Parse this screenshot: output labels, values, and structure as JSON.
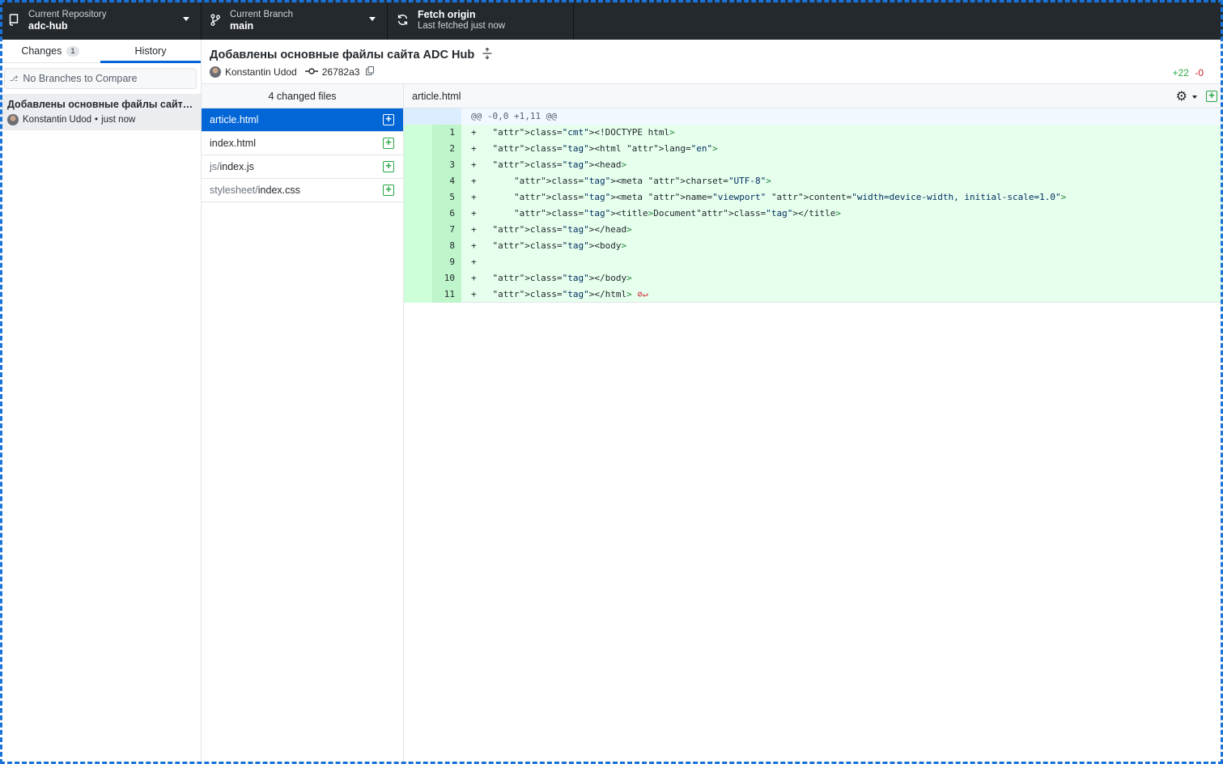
{
  "toolbar": {
    "repo": {
      "label": "Current Repository",
      "value": "adc-hub",
      "icon": "repo-icon"
    },
    "branch": {
      "label": "Current Branch",
      "value": "main",
      "icon": "branch-icon"
    },
    "fetch": {
      "label": "Fetch origin",
      "sub": "Last fetched just now",
      "icon": "sync-icon"
    }
  },
  "sidebar": {
    "tabs": [
      {
        "label": "Changes",
        "count": "1"
      },
      {
        "label": "History"
      }
    ],
    "compare_placeholder": "No Branches to Compare",
    "commit": {
      "title": "Добавлены основные файлы сайта ADC Hub",
      "author": "Konstantin Udod",
      "time": "just now"
    }
  },
  "commit_header": {
    "title": "Добавлены основные файлы сайта ADC Hub",
    "author": "Konstantin Udod",
    "sha": "26782a3",
    "additions": "+22",
    "deletions": "-0"
  },
  "files": {
    "header": "4 changed files",
    "items": [
      {
        "dir": "",
        "name": "article.html",
        "selected": true
      },
      {
        "dir": "",
        "name": "index.html",
        "selected": false
      },
      {
        "dir": "js/",
        "name": "index.js",
        "selected": false
      },
      {
        "dir": "stylesheet/",
        "name": "index.css",
        "selected": false
      }
    ]
  },
  "diff": {
    "filename": "article.html",
    "hunk": "@@ -0,0 +1,11 @@",
    "lines": [
      {
        "n": "1",
        "code": "<!DOCTYPE html>"
      },
      {
        "n": "2",
        "code": "<html lang=\"en\">"
      },
      {
        "n": "3",
        "code": "<head>"
      },
      {
        "n": "4",
        "code": "    <meta charset=\"UTF-8\">"
      },
      {
        "n": "5",
        "code": "    <meta name=\"viewport\" content=\"width=device-width, initial-scale=1.0\">"
      },
      {
        "n": "6",
        "code": "    <title>Document</title>"
      },
      {
        "n": "7",
        "code": "</head>"
      },
      {
        "n": "8",
        "code": "<body>"
      },
      {
        "n": "9",
        "code": ""
      },
      {
        "n": "10",
        "code": "</body>"
      },
      {
        "n": "11",
        "code": "</html>"
      }
    ]
  },
  "colors": {
    "accent": "#0366d6",
    "toolbar": "#24292e",
    "added": "#e6ffed",
    "add_gutter": "#bef5cb"
  }
}
